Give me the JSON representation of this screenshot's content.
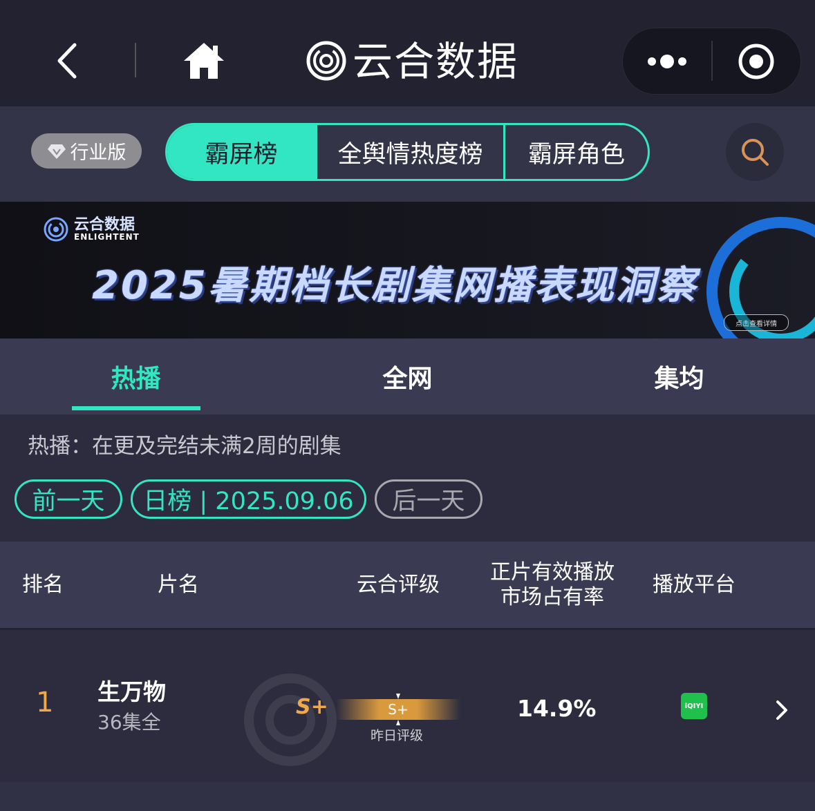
{
  "header": {
    "app_title": "云合数据",
    "icons": {
      "back": "chevron-left-icon",
      "home": "home-icon",
      "logo": "yunhe-logo-icon",
      "more": "more-dots-icon",
      "close": "target-close-icon"
    }
  },
  "toolbar": {
    "edition_label": "行业版",
    "segments": [
      {
        "label": "霸屏榜",
        "active": true
      },
      {
        "label": "全舆情热度榜",
        "active": false
      },
      {
        "label": "霸屏角色",
        "active": false
      }
    ],
    "search_icon": "search-icon"
  },
  "banner": {
    "brand": "云合数据",
    "brand_en": "ENLIGHTENT",
    "title": "2025暑期档长剧集网播表现洞察",
    "cta": "点击查看详情"
  },
  "tabs": [
    {
      "label": "热播",
      "active": true
    },
    {
      "label": "全网",
      "active": false
    },
    {
      "label": "集均",
      "active": false
    }
  ],
  "description": "热播：在更及完结未满2周的剧集",
  "date_nav": {
    "prev_label": "前一天",
    "current_label": "日榜 | 2025.09.06",
    "next_label": "后一天"
  },
  "table": {
    "headers": {
      "rank": "排名",
      "title": "片名",
      "grade": "云合评级",
      "share_line1": "正片有效播放",
      "share_line2": "市场占有率",
      "platform": "播放平台"
    },
    "rows": [
      {
        "rank": "1",
        "title": "生万物",
        "subtitle": "36集全",
        "grade": "S+",
        "yesterday_grade": "S+",
        "yesterday_label": "昨日评级",
        "share": "14.9%",
        "platform": "iQIYI",
        "platform_color": "#1fc14c"
      }
    ]
  },
  "colors": {
    "accent": "#32e6c3",
    "grade": "#f0a84a",
    "background": "#2c2c3e"
  }
}
